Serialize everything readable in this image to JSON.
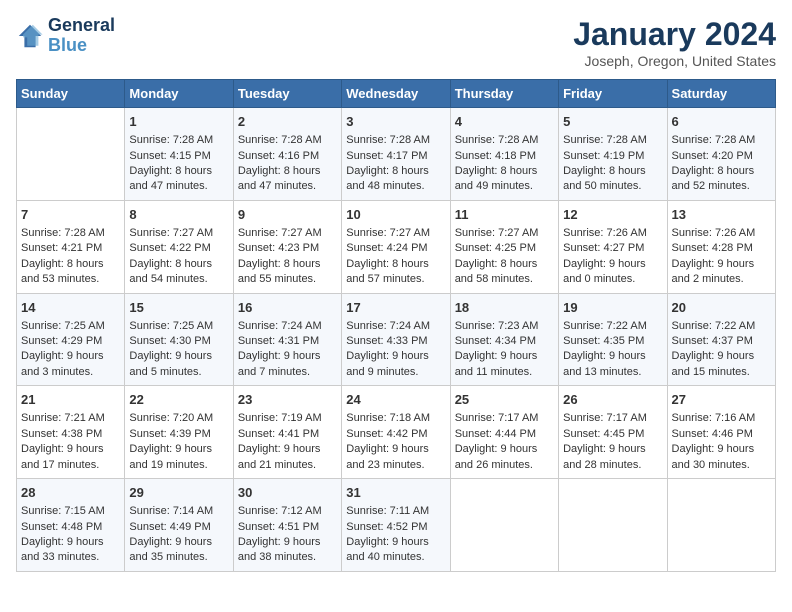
{
  "logo": {
    "line1": "General",
    "line2": "Blue"
  },
  "title": "January 2024",
  "location": "Joseph, Oregon, United States",
  "days_header": [
    "Sunday",
    "Monday",
    "Tuesday",
    "Wednesday",
    "Thursday",
    "Friday",
    "Saturday"
  ],
  "weeks": [
    [
      {
        "num": "",
        "content": ""
      },
      {
        "num": "1",
        "content": "Sunrise: 7:28 AM\nSunset: 4:15 PM\nDaylight: 8 hours and 47 minutes."
      },
      {
        "num": "2",
        "content": "Sunrise: 7:28 AM\nSunset: 4:16 PM\nDaylight: 8 hours and 47 minutes."
      },
      {
        "num": "3",
        "content": "Sunrise: 7:28 AM\nSunset: 4:17 PM\nDaylight: 8 hours and 48 minutes."
      },
      {
        "num": "4",
        "content": "Sunrise: 7:28 AM\nSunset: 4:18 PM\nDaylight: 8 hours and 49 minutes."
      },
      {
        "num": "5",
        "content": "Sunrise: 7:28 AM\nSunset: 4:19 PM\nDaylight: 8 hours and 50 minutes."
      },
      {
        "num": "6",
        "content": "Sunrise: 7:28 AM\nSunset: 4:20 PM\nDaylight: 8 hours and 52 minutes."
      }
    ],
    [
      {
        "num": "7",
        "content": "Sunrise: 7:28 AM\nSunset: 4:21 PM\nDaylight: 8 hours and 53 minutes."
      },
      {
        "num": "8",
        "content": "Sunrise: 7:27 AM\nSunset: 4:22 PM\nDaylight: 8 hours and 54 minutes."
      },
      {
        "num": "9",
        "content": "Sunrise: 7:27 AM\nSunset: 4:23 PM\nDaylight: 8 hours and 55 minutes."
      },
      {
        "num": "10",
        "content": "Sunrise: 7:27 AM\nSunset: 4:24 PM\nDaylight: 8 hours and 57 minutes."
      },
      {
        "num": "11",
        "content": "Sunrise: 7:27 AM\nSunset: 4:25 PM\nDaylight: 8 hours and 58 minutes."
      },
      {
        "num": "12",
        "content": "Sunrise: 7:26 AM\nSunset: 4:27 PM\nDaylight: 9 hours and 0 minutes."
      },
      {
        "num": "13",
        "content": "Sunrise: 7:26 AM\nSunset: 4:28 PM\nDaylight: 9 hours and 2 minutes."
      }
    ],
    [
      {
        "num": "14",
        "content": "Sunrise: 7:25 AM\nSunset: 4:29 PM\nDaylight: 9 hours and 3 minutes."
      },
      {
        "num": "15",
        "content": "Sunrise: 7:25 AM\nSunset: 4:30 PM\nDaylight: 9 hours and 5 minutes."
      },
      {
        "num": "16",
        "content": "Sunrise: 7:24 AM\nSunset: 4:31 PM\nDaylight: 9 hours and 7 minutes."
      },
      {
        "num": "17",
        "content": "Sunrise: 7:24 AM\nSunset: 4:33 PM\nDaylight: 9 hours and 9 minutes."
      },
      {
        "num": "18",
        "content": "Sunrise: 7:23 AM\nSunset: 4:34 PM\nDaylight: 9 hours and 11 minutes."
      },
      {
        "num": "19",
        "content": "Sunrise: 7:22 AM\nSunset: 4:35 PM\nDaylight: 9 hours and 13 minutes."
      },
      {
        "num": "20",
        "content": "Sunrise: 7:22 AM\nSunset: 4:37 PM\nDaylight: 9 hours and 15 minutes."
      }
    ],
    [
      {
        "num": "21",
        "content": "Sunrise: 7:21 AM\nSunset: 4:38 PM\nDaylight: 9 hours and 17 minutes."
      },
      {
        "num": "22",
        "content": "Sunrise: 7:20 AM\nSunset: 4:39 PM\nDaylight: 9 hours and 19 minutes."
      },
      {
        "num": "23",
        "content": "Sunrise: 7:19 AM\nSunset: 4:41 PM\nDaylight: 9 hours and 21 minutes."
      },
      {
        "num": "24",
        "content": "Sunrise: 7:18 AM\nSunset: 4:42 PM\nDaylight: 9 hours and 23 minutes."
      },
      {
        "num": "25",
        "content": "Sunrise: 7:17 AM\nSunset: 4:44 PM\nDaylight: 9 hours and 26 minutes."
      },
      {
        "num": "26",
        "content": "Sunrise: 7:17 AM\nSunset: 4:45 PM\nDaylight: 9 hours and 28 minutes."
      },
      {
        "num": "27",
        "content": "Sunrise: 7:16 AM\nSunset: 4:46 PM\nDaylight: 9 hours and 30 minutes."
      }
    ],
    [
      {
        "num": "28",
        "content": "Sunrise: 7:15 AM\nSunset: 4:48 PM\nDaylight: 9 hours and 33 minutes."
      },
      {
        "num": "29",
        "content": "Sunrise: 7:14 AM\nSunset: 4:49 PM\nDaylight: 9 hours and 35 minutes."
      },
      {
        "num": "30",
        "content": "Sunrise: 7:12 AM\nSunset: 4:51 PM\nDaylight: 9 hours and 38 minutes."
      },
      {
        "num": "31",
        "content": "Sunrise: 7:11 AM\nSunset: 4:52 PM\nDaylight: 9 hours and 40 minutes."
      },
      {
        "num": "",
        "content": ""
      },
      {
        "num": "",
        "content": ""
      },
      {
        "num": "",
        "content": ""
      }
    ]
  ]
}
